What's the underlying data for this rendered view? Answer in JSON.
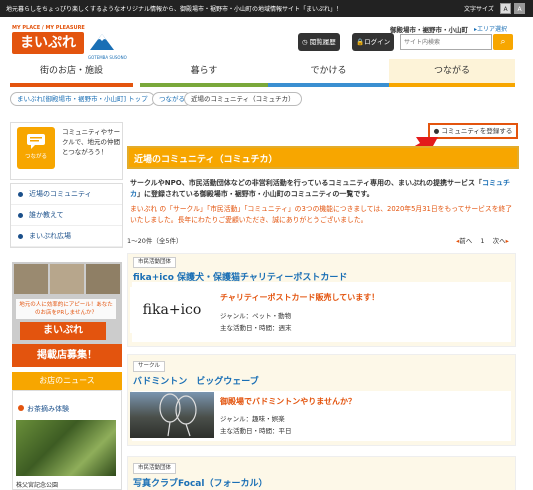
{
  "topbar": {
    "tagline": "地元暮らしをちょっぴり楽しくするようなオリジナル情報から、御殿場市・裾野市・小山町の地域情報サイト「まいぷれ」！",
    "font_size_label": "文字サイズ",
    "font_small": "A",
    "font_large": "A"
  },
  "header": {
    "logo_small": "MY PLACE / MY PLEASURE",
    "logo_main": "まいぷれ",
    "logo_sub": "GOTEMBA SUSONO",
    "area": "御殿場市・裾野市・小山町",
    "area_select": "エリア選択",
    "history_label": "閲覧履歴",
    "login_label": "ログイン",
    "search_placeholder": "サイト内検索"
  },
  "nav": {
    "items": [
      {
        "label": "街のお店・施設",
        "color": "#e3540e"
      },
      {
        "label": "暮らす",
        "color": "#7aa83a"
      },
      {
        "label": "でかける",
        "color": "#3a8fd1"
      },
      {
        "label": "つながる",
        "color": "#f7a600"
      }
    ]
  },
  "breadcrumb": {
    "home": "まいぷれ[御殿場市・裾野市・小山町] トップ",
    "parent": "つながる",
    "current": "近場のコミュニティ（コミュチカ）"
  },
  "sidebar": {
    "icon_label": "つながる",
    "desc": "コミュニティやサークルで、地元の仲間とつながろう！",
    "menu": [
      {
        "label": "近場のコミュニティ"
      },
      {
        "label": "誰か教えて"
      },
      {
        "label": "まいぷれ広場"
      }
    ],
    "ad_text": "地元の人に効率的にアピール！あなたのお店をPRしませんか？",
    "ad_logo": "まいぷれ",
    "ad_bottom": "掲載店募集！",
    "news_head": "お店のニュース",
    "news_item": "お茶摘み体験",
    "news_caption": "株父宮記念公園"
  },
  "main": {
    "register_btn": "コミュニティを登録する",
    "title": "近場のコミュニティ（コミュチカ）",
    "intro_1": "サークルやNPO、市民活動団体などの非営利活動を行っているコミュニティ専用の、まいぷれの提携サービス「",
    "intro_hl": "コミュチカ",
    "intro_2": "」に登録されている御殿場市・裾野市・小山町のコミュニティの一覧です。",
    "notice": "まいぷれ の「サークル」「市民活動」「コミュニティ」の3つの機能につきましては、2020年5月31日をもってサービスを終了いたしました。長年にわたりご愛顧いただき、誠にありがとうございました。",
    "count": "1〜20件（全5件）",
    "pager_prev": "前へ",
    "pager_page": "1",
    "pager_next": "次へ"
  },
  "cards": [
    {
      "tag": "市民活動団体",
      "title": "fika+ico 保護犬・保護猫チャリティーポストカード",
      "head": "チャリティーポストカード販売しています！",
      "genre": "ジャンル：ペット・動物",
      "time": "主な活動日・時間：週末",
      "img_text": "fika+ico"
    },
    {
      "tag": "サークル",
      "title": "バドミントン　ビッグウェーブ",
      "head": "御殿場でバドミントンやりませんか？",
      "genre": "ジャンル：趣味・娯楽",
      "time": "主な活動日・時間：平日"
    },
    {
      "tag": "市民活動団体",
      "title": "写真クラブFocal（フォーカル）"
    }
  ],
  "colors": {
    "accent": "#f7a600",
    "brand": "#e3540e",
    "link": "#1a6fb5"
  }
}
